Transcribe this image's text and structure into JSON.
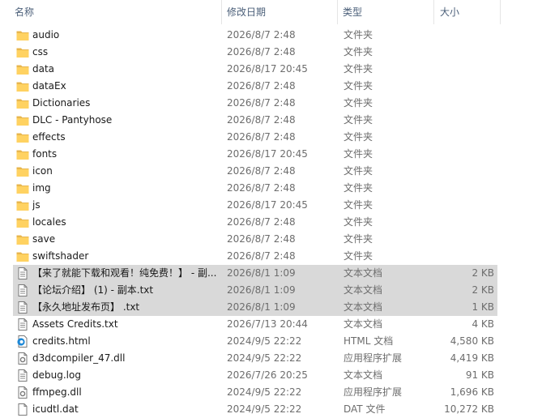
{
  "header": {
    "name": "名称",
    "date": "修改日期",
    "type": "类型",
    "size": "大小",
    "sort_indicator": "^"
  },
  "rows": [
    {
      "name": "audio",
      "date": "2026/8/7 2:48",
      "type": "文件夹",
      "size": "",
      "icon": "folder-icon",
      "selected": false
    },
    {
      "name": "css",
      "date": "2026/8/7 2:48",
      "type": "文件夹",
      "size": "",
      "icon": "folder-icon",
      "selected": false
    },
    {
      "name": "data",
      "date": "2026/8/17 20:45",
      "type": "文件夹",
      "size": "",
      "icon": "folder-icon",
      "selected": false
    },
    {
      "name": "dataEx",
      "date": "2026/8/7 2:48",
      "type": "文件夹",
      "size": "",
      "icon": "folder-icon",
      "selected": false
    },
    {
      "name": "Dictionaries",
      "date": "2026/8/7 2:48",
      "type": "文件夹",
      "size": "",
      "icon": "folder-icon",
      "selected": false
    },
    {
      "name": "DLC - Pantyhose",
      "date": "2026/8/7 2:48",
      "type": "文件夹",
      "size": "",
      "icon": "folder-icon",
      "selected": false
    },
    {
      "name": "effects",
      "date": "2026/8/7 2:48",
      "type": "文件夹",
      "size": "",
      "icon": "folder-icon",
      "selected": false
    },
    {
      "name": "fonts",
      "date": "2026/8/17 20:45",
      "type": "文件夹",
      "size": "",
      "icon": "folder-icon",
      "selected": false
    },
    {
      "name": "icon",
      "date": "2026/8/7 2:48",
      "type": "文件夹",
      "size": "",
      "icon": "folder-icon",
      "selected": false
    },
    {
      "name": "img",
      "date": "2026/8/7 2:48",
      "type": "文件夹",
      "size": "",
      "icon": "folder-icon",
      "selected": false
    },
    {
      "name": "js",
      "date": "2026/8/17 20:45",
      "type": "文件夹",
      "size": "",
      "icon": "folder-icon",
      "selected": false
    },
    {
      "name": "locales",
      "date": "2026/8/7 2:48",
      "type": "文件夹",
      "size": "",
      "icon": "folder-icon",
      "selected": false
    },
    {
      "name": "save",
      "date": "2026/8/7 2:48",
      "type": "文件夹",
      "size": "",
      "icon": "folder-icon",
      "selected": false
    },
    {
      "name": "swiftshader",
      "date": "2026/8/7 2:48",
      "type": "文件夹",
      "size": "",
      "icon": "folder-icon",
      "selected": false
    },
    {
      "name": "【来了就能下载和观看！纯免费！】 - 副...",
      "date": "2026/8/1 1:09",
      "type": "文本文档",
      "size": "2 KB",
      "icon": "text-file-icon",
      "selected": true
    },
    {
      "name": "【论坛介绍】  (1) - 副本.txt",
      "date": "2026/8/1 1:09",
      "type": "文本文档",
      "size": "2 KB",
      "icon": "text-file-icon",
      "selected": true
    },
    {
      "name": "【永久地址发布页】 .txt",
      "date": "2026/8/1 1:09",
      "type": "文本文档",
      "size": "1 KB",
      "icon": "text-file-icon",
      "selected": true
    },
    {
      "name": "Assets Credits.txt",
      "date": "2026/7/13 20:44",
      "type": "文本文档",
      "size": "4 KB",
      "icon": "text-file-icon",
      "selected": false
    },
    {
      "name": "credits.html",
      "date": "2024/9/5 22:22",
      "type": "HTML 文档",
      "size": "4,580 KB",
      "icon": "edge-html-icon",
      "selected": false
    },
    {
      "name": "d3dcompiler_47.dll",
      "date": "2024/9/5 22:22",
      "type": "应用程序扩展",
      "size": "4,419 KB",
      "icon": "dll-file-icon",
      "selected": false
    },
    {
      "name": "debug.log",
      "date": "2026/7/26 20:25",
      "type": "文本文档",
      "size": "91 KB",
      "icon": "text-file-icon",
      "selected": false
    },
    {
      "name": "ffmpeg.dll",
      "date": "2024/9/5 22:22",
      "type": "应用程序扩展",
      "size": "1,696 KB",
      "icon": "dll-file-icon",
      "selected": false
    },
    {
      "name": "icudtl.dat",
      "date": "2024/9/5 22:22",
      "type": "DAT 文件",
      "size": "10,272 KB",
      "icon": "generic-file-icon",
      "selected": false
    }
  ]
}
